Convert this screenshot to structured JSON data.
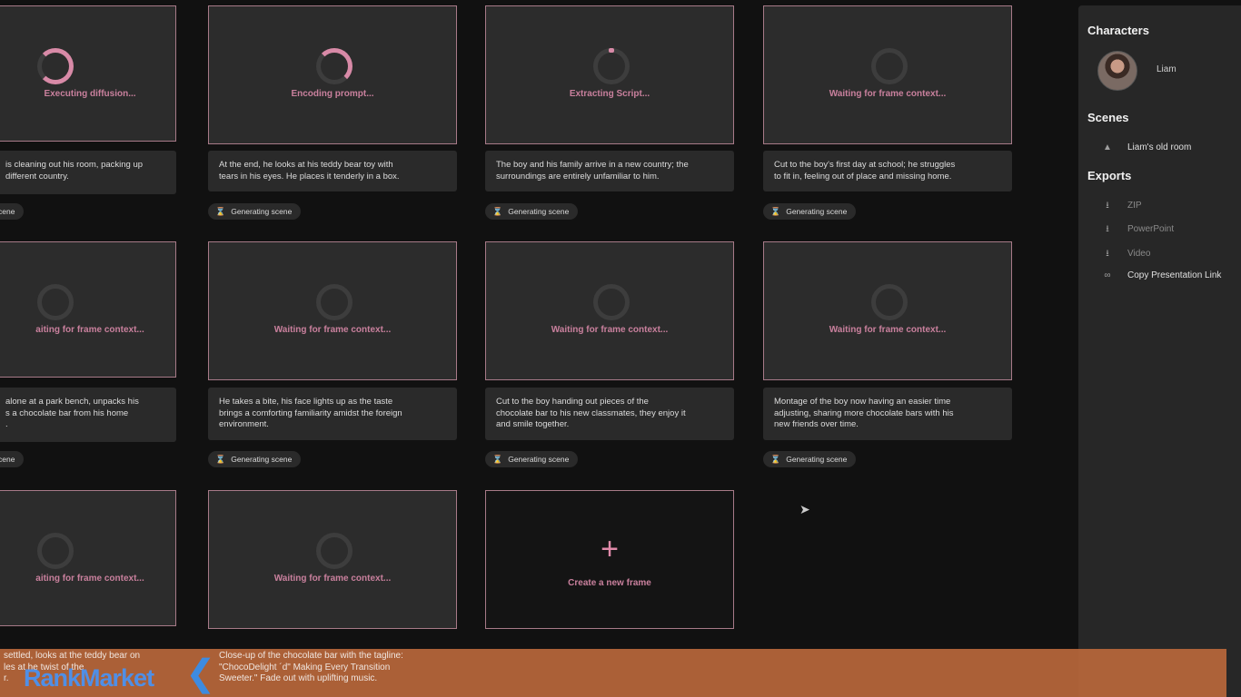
{
  "grid": {
    "row1": [
      {
        "status": "Executing diffusion...",
        "desc": "is cleaning out his room, packing up\ndifferent country.",
        "badge": "cene",
        "spinner": "lg"
      },
      {
        "status": "Encoding prompt...",
        "desc": "At the end, he looks at his teddy bear toy with\ntears in his eyes. He places it tenderly in a box.",
        "badge": "Generating scene",
        "spinner": "md"
      },
      {
        "status": "Extracting Script...",
        "desc": "The boy and his family arrive in a new country; the\nsurroundings are entirely unfamiliar to him.",
        "badge": "Generating scene",
        "spinner": "sm"
      },
      {
        "status": "Waiting for frame context...",
        "desc": "Cut to the boy's first day at school; he struggles\nto fit in, feeling out of place and missing home.",
        "badge": "Generating scene",
        "spinner": "none"
      }
    ],
    "row2": [
      {
        "status": "aiting for frame context...",
        "desc": "alone at a park bench, unpacks his\ns a chocolate bar from his home\n.",
        "badge": "cene",
        "spinner": "none"
      },
      {
        "status": "Waiting for frame context...",
        "desc": "He takes a bite, his face lights up as the taste\nbrings a comforting familiarity amidst the foreign\nenvironment.",
        "badge": "Generating scene",
        "spinner": "none"
      },
      {
        "status": "Waiting for frame context...",
        "desc": "Cut to the boy handing out pieces of the\nchocolate bar to his new classmates, they enjoy it\nand smile together.",
        "badge": "Generating scene",
        "spinner": "none"
      },
      {
        "status": "Waiting for frame context...",
        "desc": "Montage of the boy now having an easier time\nadjusting, sharing more chocolate bars with his\nnew friends over time.",
        "badge": "Generating scene",
        "spinner": "none"
      }
    ],
    "row3": [
      {
        "status": "aiting for frame context...",
        "spinner": "none"
      },
      {
        "status": "Waiting for frame context...",
        "spinner": "none"
      }
    ],
    "create_label": "Create a new frame",
    "create_icon": "+"
  },
  "sidebar": {
    "characters_heading": "Characters",
    "character_name": "Liam",
    "scenes_heading": "Scenes",
    "scene_name": "Liam's old room",
    "exports_heading": "Exports",
    "exports": [
      {
        "label": "ZIP",
        "icon": "download-icon"
      },
      {
        "label": "PowerPoint",
        "icon": "download-icon"
      },
      {
        "label": "Video",
        "icon": "download-icon"
      },
      {
        "label": "Copy Presentation Link",
        "icon": "link-icon"
      }
    ]
  },
  "banner": {
    "logo": "RankMarket",
    "partial_text": "settled, looks at the teddy bear on\nles at he twist of the\nr.",
    "partial_text2": "Close-up of the chocolate bar with the tagline:\n\"ChocoDelight ´d\" Making Every Transition\nSweeter.\" Fade out with uplifting music."
  }
}
